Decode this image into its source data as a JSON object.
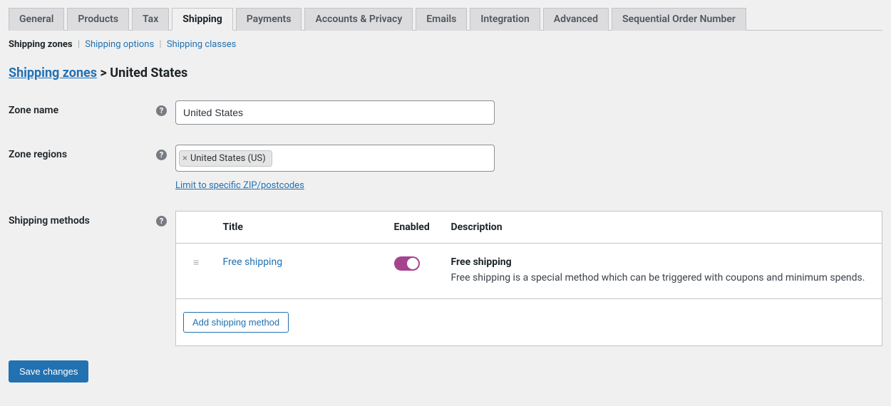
{
  "tabs": [
    {
      "label": "General"
    },
    {
      "label": "Products"
    },
    {
      "label": "Tax"
    },
    {
      "label": "Shipping",
      "active": true
    },
    {
      "label": "Payments"
    },
    {
      "label": "Accounts & Privacy"
    },
    {
      "label": "Emails"
    },
    {
      "label": "Integration"
    },
    {
      "label": "Advanced"
    },
    {
      "label": "Sequential Order Number"
    }
  ],
  "subnav": {
    "zones": "Shipping zones",
    "options": "Shipping options",
    "classes": "Shipping classes"
  },
  "breadcrumb": {
    "link": "Shipping zones",
    "sep": ">",
    "current": "United States"
  },
  "form": {
    "zone_name_label": "Zone name",
    "zone_name_value": "United States",
    "zone_regions_label": "Zone regions",
    "zone_region_tag": "United States (US)",
    "zip_link": "Limit to specific ZIP/postcodes",
    "shipping_methods_label": "Shipping methods"
  },
  "table": {
    "head": {
      "title": "Title",
      "enabled": "Enabled",
      "description": "Description"
    },
    "rows": [
      {
        "title": "Free shipping",
        "enabled": true,
        "desc_title": "Free shipping",
        "desc_text": "Free shipping is a special method which can be triggered with coupons and minimum spends."
      }
    ],
    "add_button": "Add shipping method"
  },
  "save_button": "Save changes"
}
